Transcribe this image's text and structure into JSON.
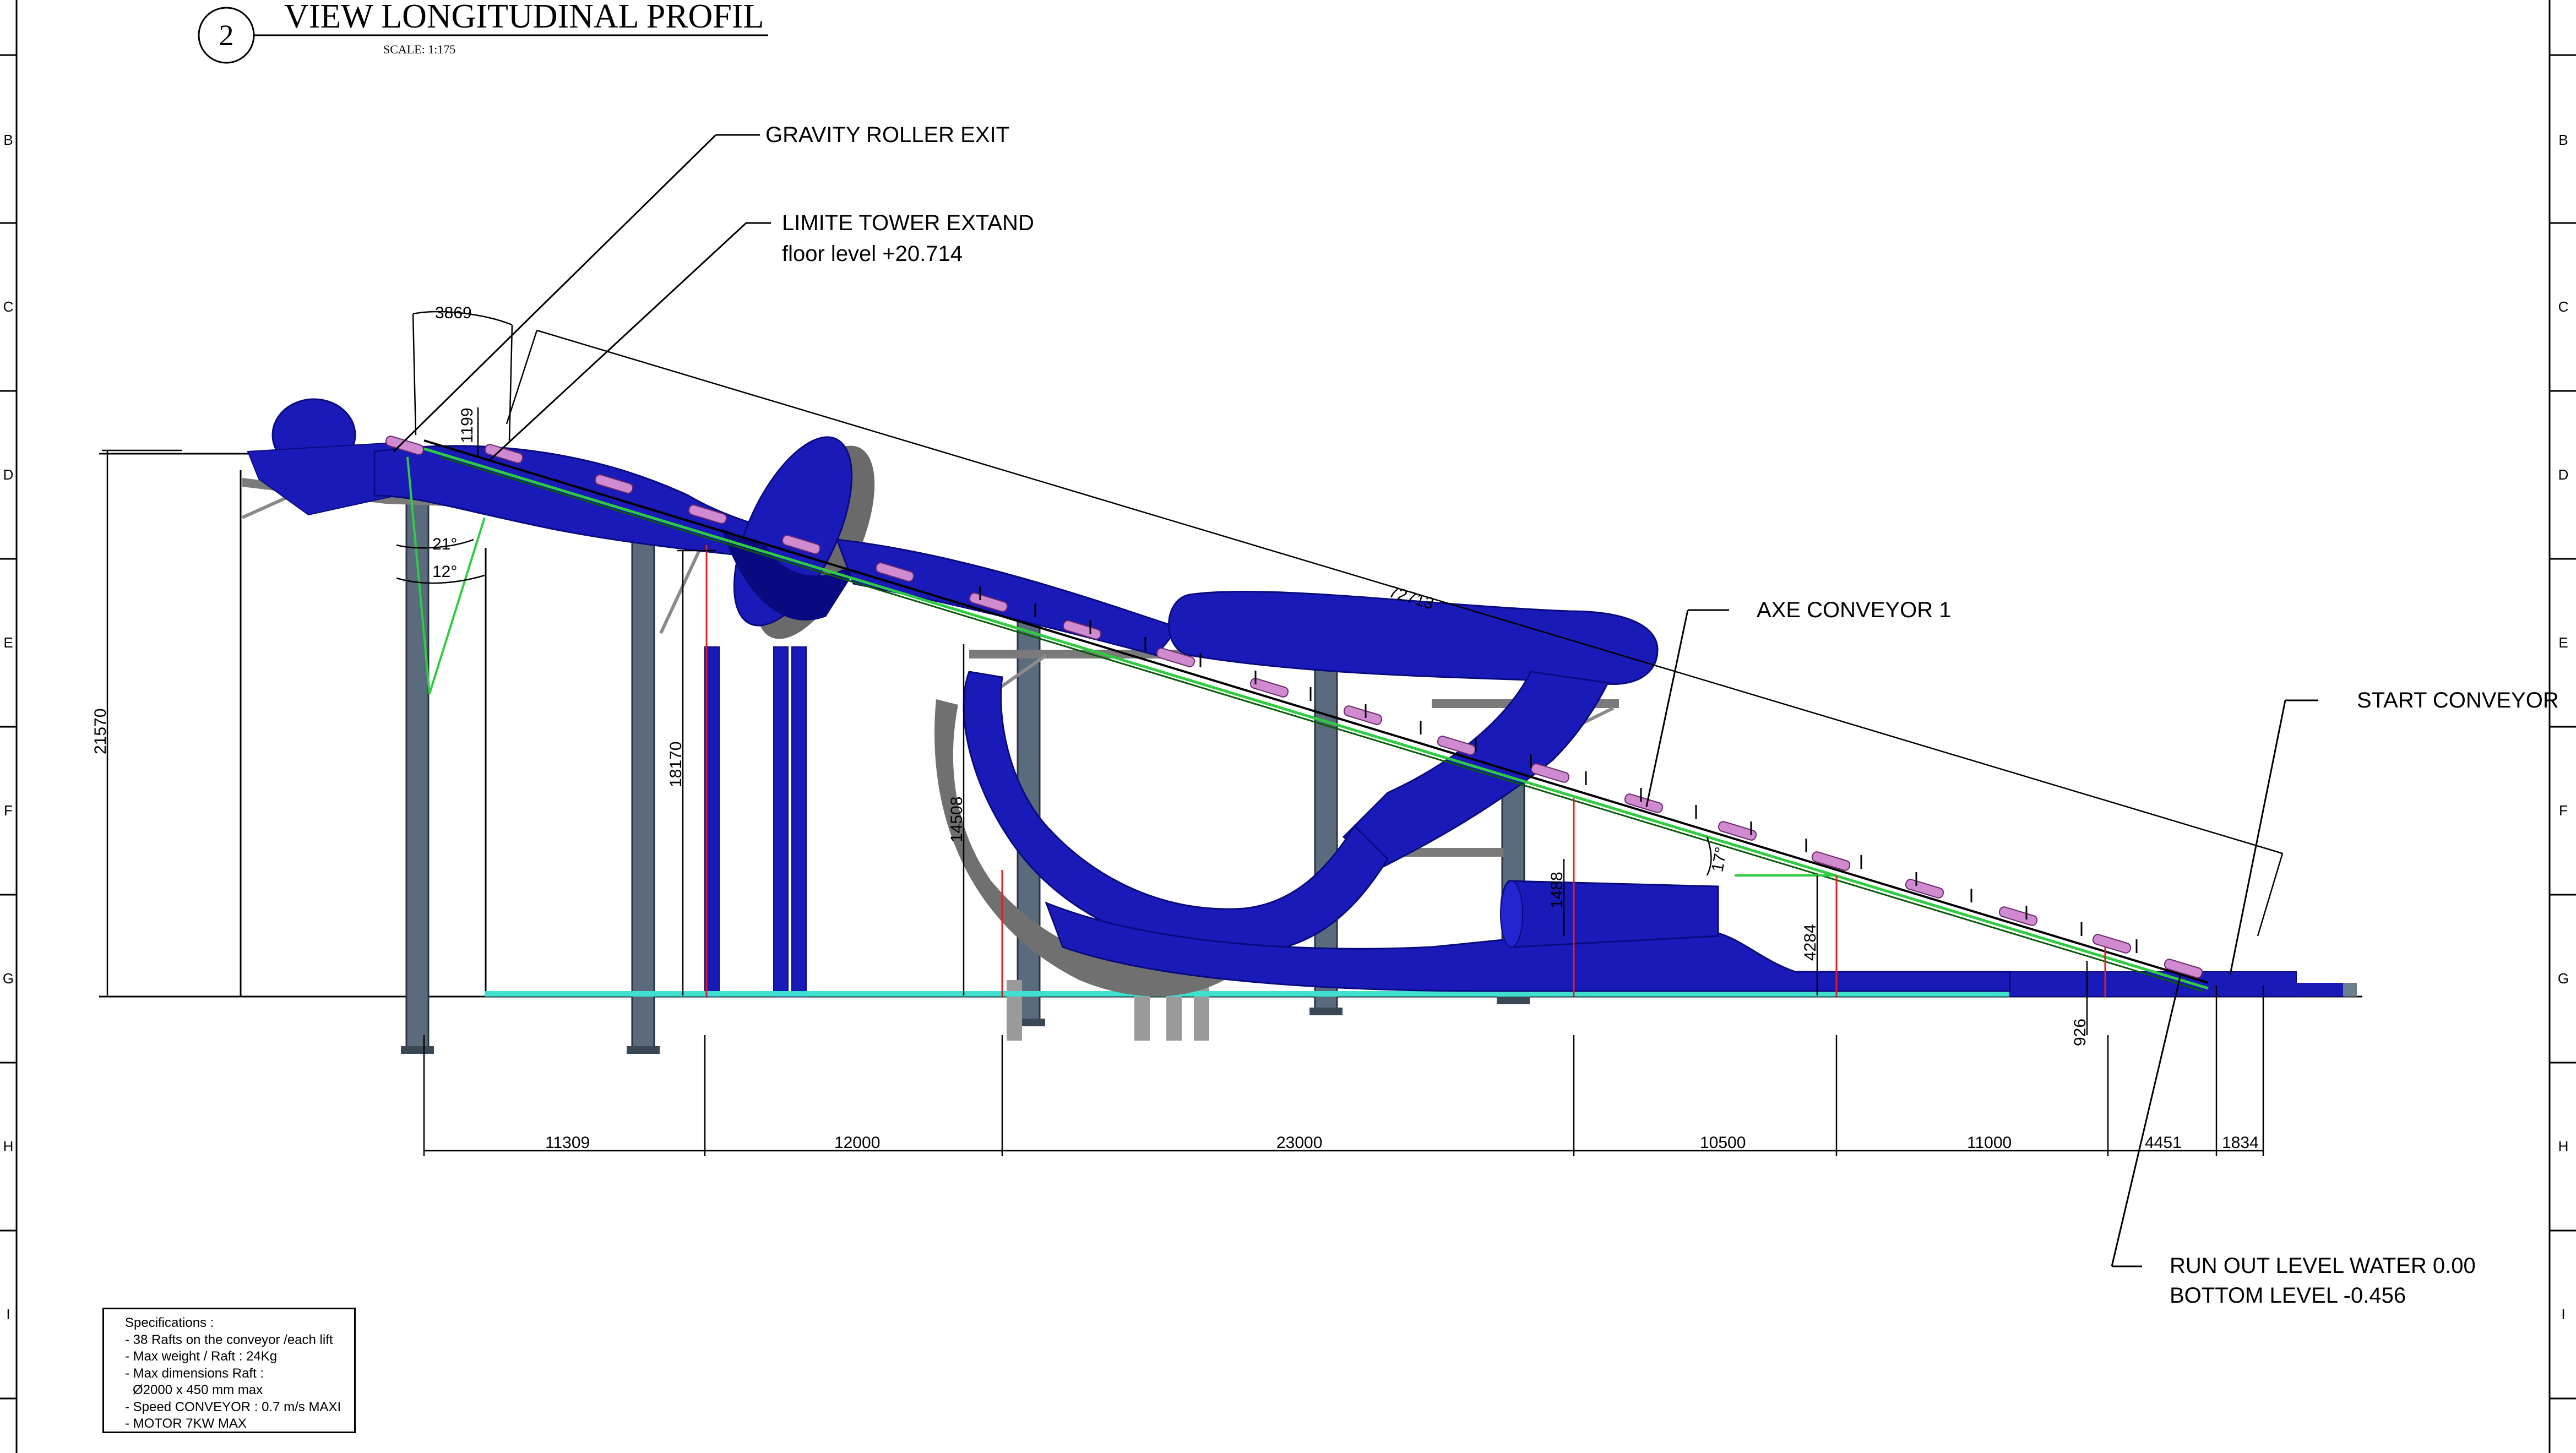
{
  "title": {
    "number": "2",
    "text": "VIEW LONGITUDINAL PROFIL",
    "scale": "SCALE: 1:175"
  },
  "grid_letters": [
    "B",
    "C",
    "D",
    "E",
    "F",
    "G",
    "H",
    "I"
  ],
  "callouts": {
    "gravity_roller_exit": "GRAVITY ROLLER EXIT",
    "limite_tower_extand": "LIMITE TOWER EXTAND",
    "floor_level": "floor level +20.714",
    "axe_conveyor": "AXE CONVEYOR 1",
    "start_conveyor": "START CONVEYOR",
    "run_out_level": "RUN OUT LEVEL WATER 0.00",
    "bottom_level": "BOTTOM LEVEL -0.456"
  },
  "dimensions": {
    "top_radius": "3869",
    "small_vertical": "1199",
    "angle_21": "21°",
    "angle_12": "12°",
    "diagonal_length": "72713",
    "total_height": "21570",
    "height_18170": "18170",
    "height_14508": "14508",
    "height_4284": "4284",
    "height_1488": "1488",
    "height_926": "926",
    "angle_17": "17°",
    "horizontal": [
      "11309",
      "12000",
      "23000",
      "10500",
      "11000",
      "4451",
      "1834"
    ]
  },
  "specifications": {
    "heading": "Specifications :",
    "lines": [
      "- 38 Rafts on the conveyor /each lift",
      "- Max weight / Raft : 24Kg",
      "- Max dimensions Raft :",
      "  Ø2000 x 450 mm max",
      "- Speed CONVEYOR : 0.7 m/s MAXI",
      "- MOTOR  7KW MAX"
    ]
  },
  "colors": {
    "slide_blue": "#1a1ab8",
    "slide_dark": "#0a0a80",
    "steel_grey": "#5a6b7d",
    "raft_pink": "#d08ad0",
    "guide_green": "#2ecc40",
    "water_cyan": "#40e0d0",
    "dim_red": "#e02020"
  }
}
